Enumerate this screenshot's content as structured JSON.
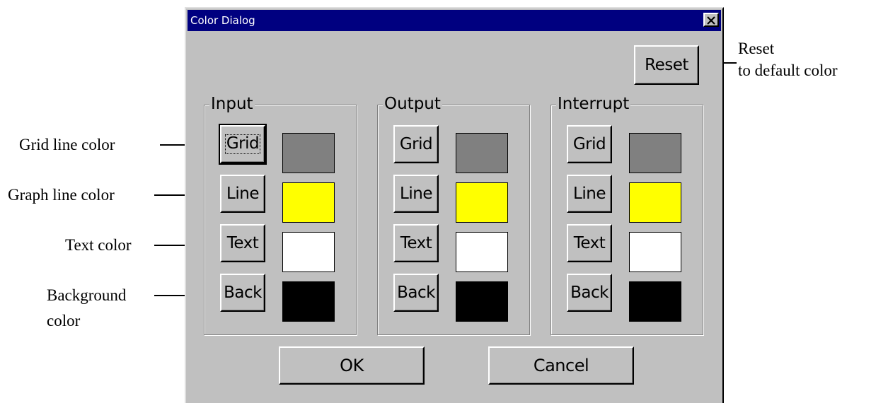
{
  "window": {
    "title": "Color Dialog",
    "close_glyph": "✕",
    "reset_label": "Reset",
    "ok_label": "OK",
    "cancel_label": "Cancel"
  },
  "groups": [
    {
      "title": "Input",
      "rows": [
        {
          "label": "Grid",
          "color": "#808080",
          "focused": true
        },
        {
          "label": "Line",
          "color": "#ffff00"
        },
        {
          "label": "Text",
          "color": "#ffffff"
        },
        {
          "label": "Back",
          "color": "#000000"
        }
      ]
    },
    {
      "title": "Output",
      "rows": [
        {
          "label": "Grid",
          "color": "#808080"
        },
        {
          "label": "Line",
          "color": "#ffff00"
        },
        {
          "label": "Text",
          "color": "#ffffff"
        },
        {
          "label": "Back",
          "color": "#000000"
        }
      ]
    },
    {
      "title": "Interrupt",
      "rows": [
        {
          "label": "Grid",
          "color": "#808080"
        },
        {
          "label": "Line",
          "color": "#ffff00"
        },
        {
          "label": "Text",
          "color": "#ffffff"
        },
        {
          "label": "Back",
          "color": "#000000"
        }
      ]
    }
  ],
  "annotations": {
    "grid_line": "Grid line color",
    "graph_line": "Graph line color",
    "text_color": "Text color",
    "background_line1": "Background",
    "background_line2": "color",
    "reset_line1": "Reset",
    "reset_line2": "to default color"
  },
  "colors": {
    "dialog_bg": "#c0c0c0",
    "titlebar": "#000080",
    "grid": "#808080",
    "line": "#ffff00",
    "text": "#ffffff",
    "back": "#000000"
  }
}
